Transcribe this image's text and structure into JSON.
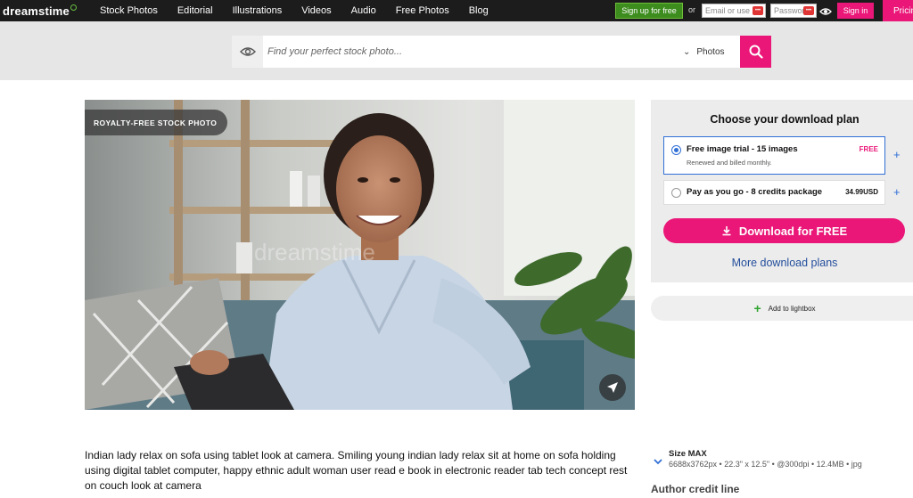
{
  "brand": {
    "logo_text": "dreamstime",
    "accent_color": "#ea1778",
    "signup_color": "#3c8c1e"
  },
  "nav": {
    "items": [
      "Stock Photos",
      "Editorial",
      "Illustrations",
      "Videos",
      "Audio",
      "Free Photos",
      "Blog"
    ]
  },
  "auth": {
    "signup_label": "Sign up for free",
    "or_label": "or",
    "email_placeholder": "Email or use",
    "password_placeholder": "Passwor",
    "signin_label": "Sign in",
    "pricing_label": "Pricing"
  },
  "search": {
    "placeholder": "Find your perfect stock photo...",
    "type_label": "Photos",
    "icons": {
      "left": "eye-icon",
      "button": "search-icon",
      "type": "chevron-down-icon"
    }
  },
  "photo": {
    "badge": "ROYALTY-FREE STOCK PHOTO",
    "watermark": "dreamstime",
    "share_icon": "paper-plane-icon"
  },
  "plans": {
    "title": "Choose your download plan",
    "options": [
      {
        "title": "Free image trial - 15 images",
        "subtitle": "Renewed and billed monthly.",
        "price": "FREE",
        "selected": true
      },
      {
        "title": "Pay as you go - 8 credits package",
        "subtitle": "",
        "price": "34.99USD",
        "selected": false
      }
    ],
    "download_label": "Download for FREE",
    "more_plans_label": "More download plans",
    "lightbox_label": "Add to lightbox"
  },
  "description": "Indian lady relax on sofa using tablet look at camera. Smiling young indian lady relax sit at home on sofa holding using digital tablet computer, happy ethnic adult woman user read e book in electronic reader tab tech concept rest on couch look at camera",
  "size": {
    "title": "Size MAX",
    "info": "6688x3762px • 22.3\" x 12.5\" • @300dpi • 12.4MB • jpg"
  },
  "author_credit_label": "Author credit line"
}
